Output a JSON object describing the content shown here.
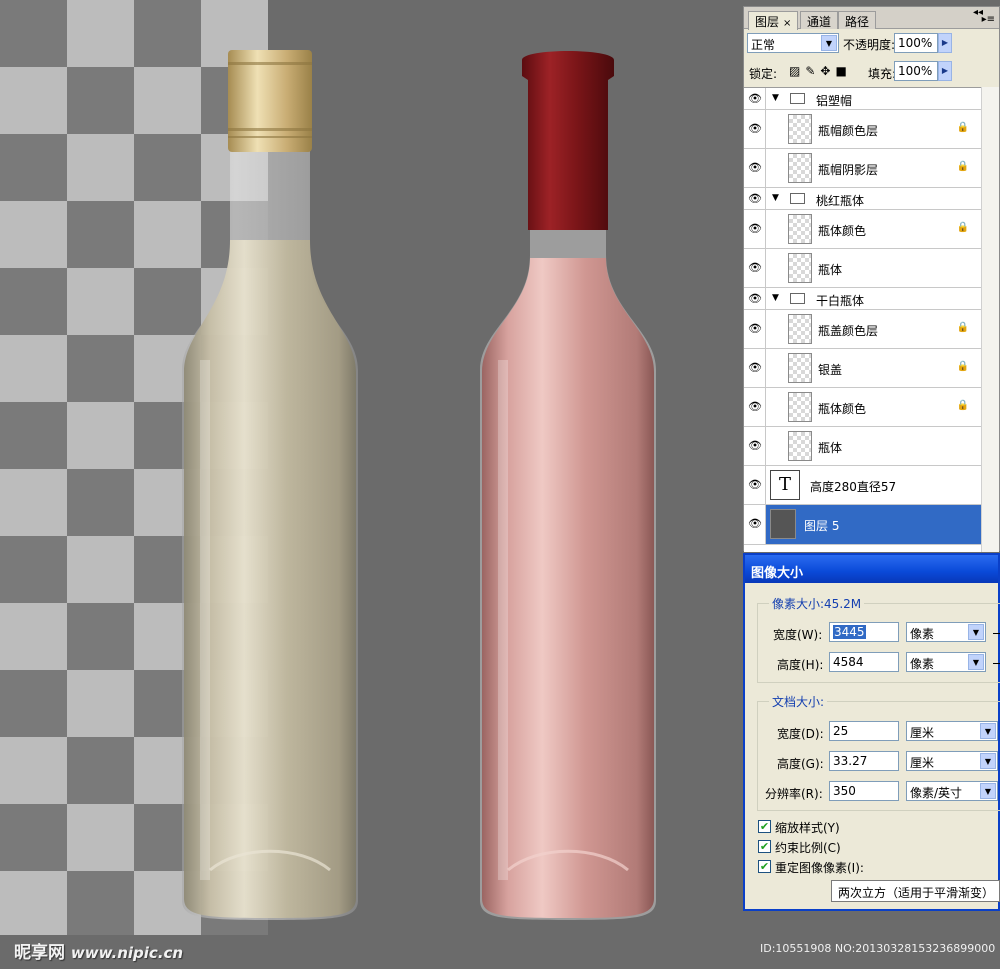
{
  "layers_panel": {
    "tabs": [
      {
        "label": "图层",
        "close": "×"
      },
      {
        "label": "通道"
      },
      {
        "label": "路径"
      }
    ],
    "blend_mode": "正常",
    "opacity_label": "不透明度:",
    "opacity_value": "100%",
    "lock_label": "锁定:",
    "fill_label": "填充:",
    "fill_value": "100%",
    "layers": [
      {
        "name": "铝塑帽",
        "type": "group"
      },
      {
        "name": "瓶帽颜色层",
        "type": "layer",
        "locked": true
      },
      {
        "name": "瓶帽阴影层",
        "type": "layer",
        "locked": true
      },
      {
        "name": "桃红瓶体",
        "type": "group"
      },
      {
        "name": "瓶体颜色",
        "type": "layer",
        "locked": true
      },
      {
        "name": "瓶体",
        "type": "layer",
        "locked": false
      },
      {
        "name": "干白瓶体",
        "type": "group"
      },
      {
        "name": "瓶盖颜色层",
        "type": "layer",
        "locked": true
      },
      {
        "name": "银盖",
        "type": "layer",
        "locked": true
      },
      {
        "name": "瓶体颜色",
        "type": "layer",
        "locked": true
      },
      {
        "name": "瓶体",
        "type": "layer",
        "locked": false
      },
      {
        "name": "高度280直径57",
        "type": "text",
        "glyph": "T"
      },
      {
        "name": "图层 5",
        "type": "layer",
        "selected": true
      }
    ]
  },
  "image_size_dialog": {
    "title": "图像大小",
    "pixel_dimensions_label": "像素大小:45.2M",
    "width_label": "宽度(W):",
    "width_value": "3445",
    "width_unit": "像素",
    "height_label": "高度(H):",
    "height_value": "4584",
    "height_unit": "像素",
    "document_size_label": "文档大小:",
    "doc_width_label": "宽度(D):",
    "doc_width_value": "25",
    "doc_width_unit": "厘米",
    "doc_height_label": "高度(G):",
    "doc_height_value": "33.27",
    "doc_height_unit": "厘米",
    "resolution_label": "分辨率(R):",
    "resolution_value": "350",
    "resolution_unit": "像素/英寸",
    "scale_styles_label": "缩放样式(Y)",
    "constrain_label": "约束比例(C)",
    "resample_label": "重定图像像素(I):",
    "resample_method": "两次立方（适用于平滑渐变）"
  },
  "canvas": {
    "watermark": "昵享网",
    "watermark_site": "www.nipic.cn",
    "image_id": "ID:10551908 NO:20130328153236899000"
  },
  "colors": {
    "white_wine": "#b7ae96",
    "rose_wine": "#c28a86",
    "red_cap": "#7a1518",
    "gold_cap": "#c9b27a",
    "selection": "#316ac5"
  }
}
